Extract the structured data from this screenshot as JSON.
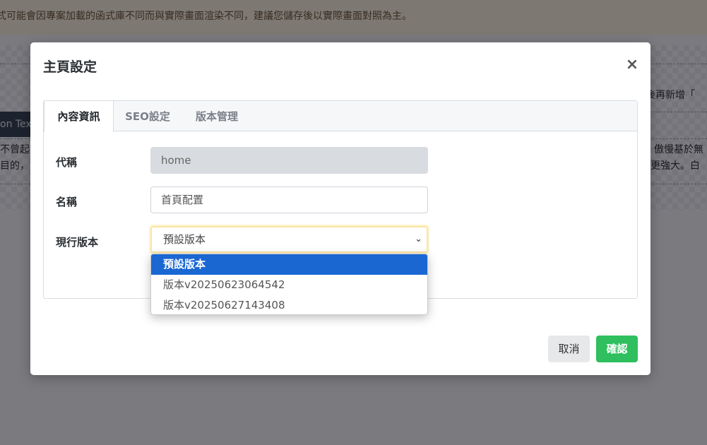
{
  "background": {
    "notice": "式可能會因專案加載的函式庫不同而與實際畫面渲染不同，建議您儲存後以實際畫面對照為主。",
    "right_text_1": "後再新增「",
    "right_text_2": "傲慢基於無",
    "right_text_3": "更強大。白",
    "left_block": "on Text",
    "left_text_1": "不曾起",
    "left_text_2": "目的，"
  },
  "modal": {
    "title": "主頁設定",
    "close_icon": "×",
    "tabs": [
      {
        "label": "內容資訊",
        "active": true
      },
      {
        "label": "SEO設定",
        "active": false
      },
      {
        "label": "版本管理",
        "active": false
      }
    ],
    "fields": {
      "alias_label": "代稱",
      "alias_value": "home",
      "name_label": "名稱",
      "name_value": "首頁配置",
      "version_label": "現行版本",
      "version_value": "預設版本"
    },
    "version_options": [
      "預設版本",
      "版本v20250623064542",
      "版本v20250627143408"
    ],
    "cancel_label": "取消",
    "confirm_label": "確認"
  },
  "colors": {
    "primary_option": "#1a67d2",
    "confirm_button": "#2fbf5e",
    "select_focus": "#fbe6a4"
  }
}
